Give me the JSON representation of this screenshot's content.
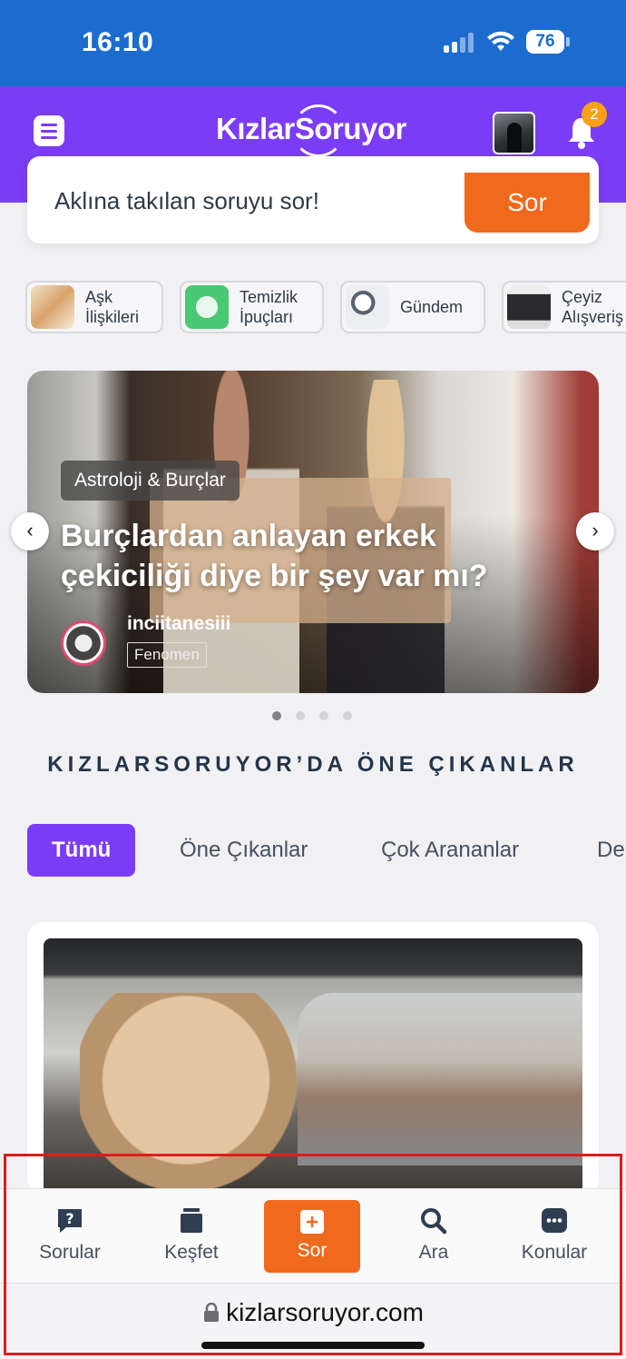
{
  "status_bar": {
    "time": "16:10",
    "battery": "76"
  },
  "header": {
    "logo_text": "KızlarSoruyor",
    "notification_count": "2"
  },
  "ask": {
    "prompt": "Aklına takılan soruyu sor!",
    "button": "Sor"
  },
  "categories": [
    {
      "label": "Aşk\nİlişkileri"
    },
    {
      "label": "Temizlik\nİpuçları"
    },
    {
      "label": "Gündem"
    },
    {
      "label": "Çeyiz\nAlışveriş"
    }
  ],
  "hero": {
    "tag": "Astroloji & Burçlar",
    "title": "Burçlardan anlayan erkek çekiciliği diye bir şey var mı?",
    "username": "inciitanesiii",
    "user_badge": "Fenomen",
    "active_slide": 1,
    "slide_count": 4
  },
  "section": {
    "title": "KIZLARSORUYOR’DA ÖNE ÇIKANLAR",
    "tabs": [
      "Tümü",
      "Öne Çıkanlar",
      "Çok Arananlar",
      "De"
    ],
    "active_tab": "Tümü"
  },
  "bottom_nav": [
    {
      "label": "Sorular",
      "icon": "question-bubble-icon"
    },
    {
      "label": "Keşfet",
      "icon": "cards-stack-icon"
    },
    {
      "label": "Sor",
      "icon": "plus-square-icon"
    },
    {
      "label": "Ara",
      "icon": "search-icon"
    },
    {
      "label": "Konular",
      "icon": "chat-dots-icon"
    }
  ],
  "url_bar": {
    "url": "kizlarsoruyor.com"
  },
  "colors": {
    "brand_purple": "#7b3cf5",
    "accent_orange": "#ef6a1c",
    "status_blue": "#1c6ccf",
    "highlight_red": "#e01c1c"
  }
}
